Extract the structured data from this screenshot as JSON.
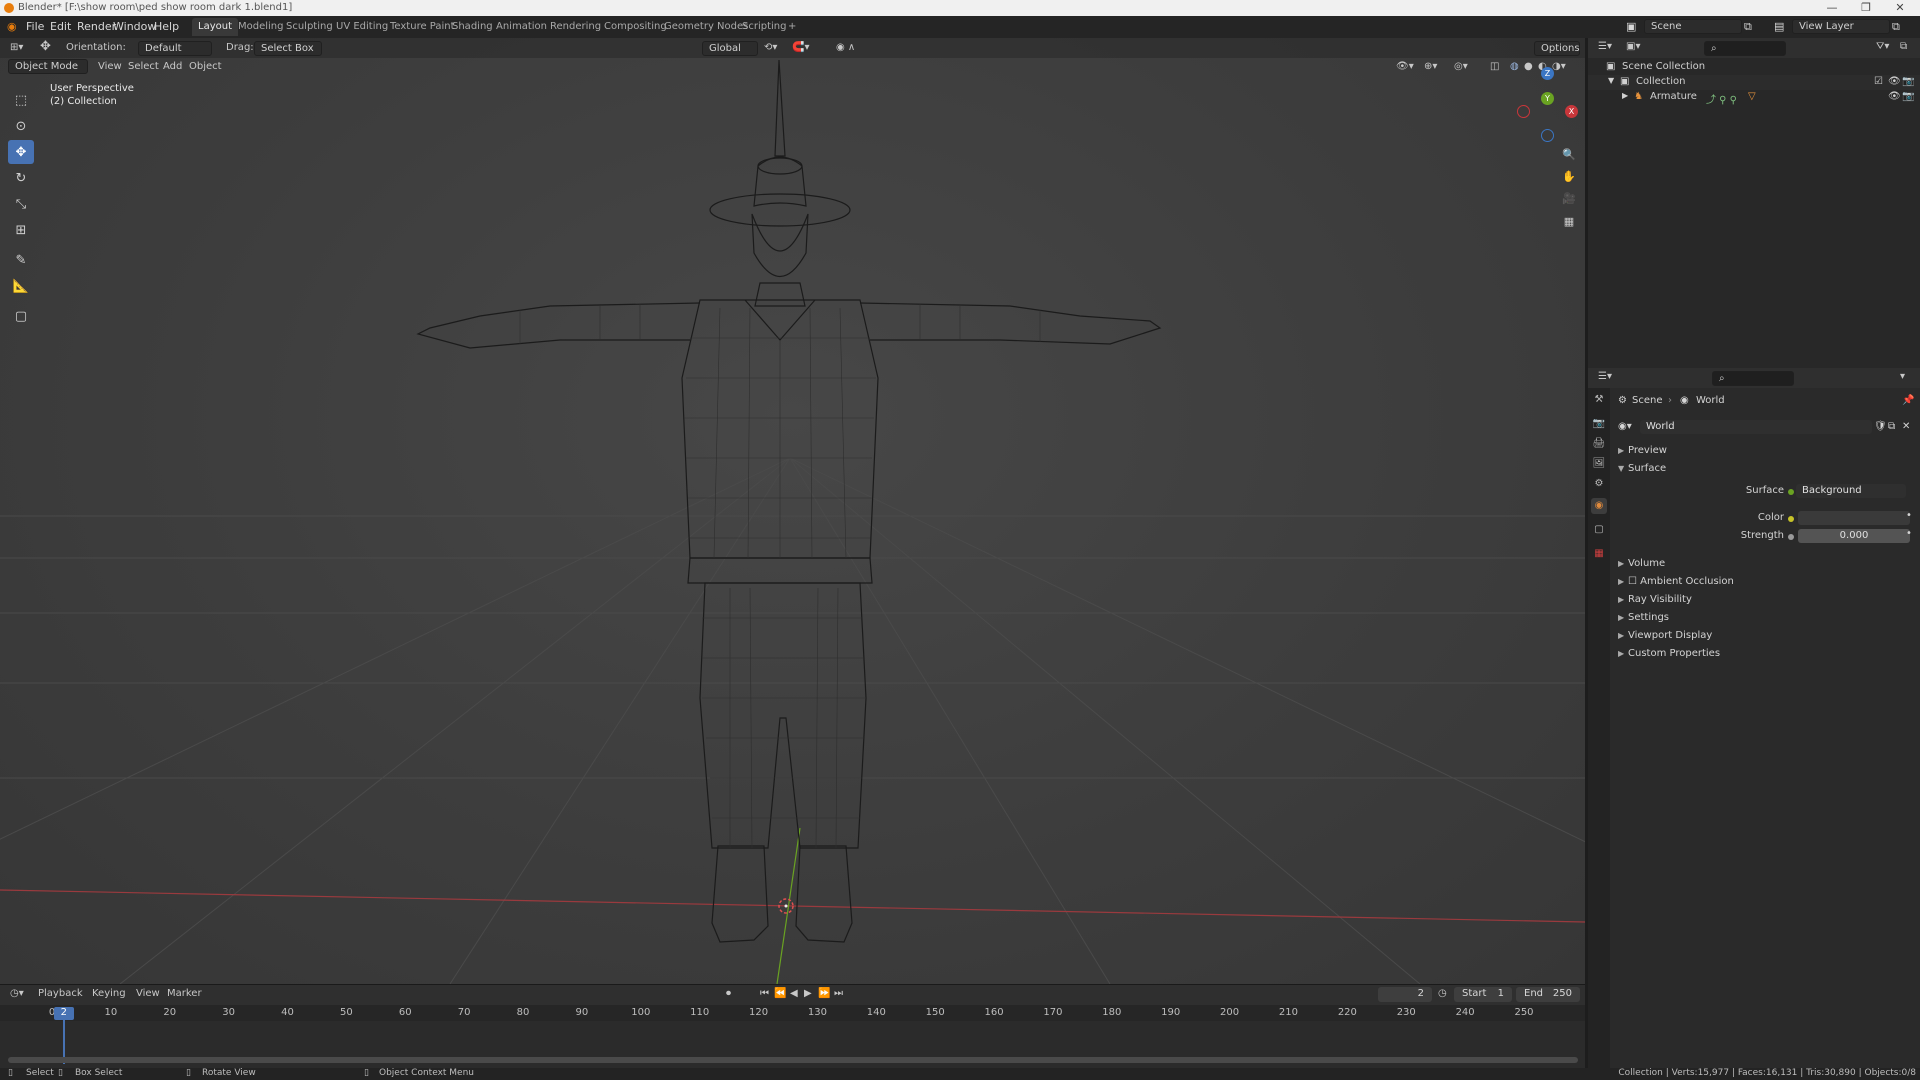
{
  "window": {
    "title": "Blender* [F:\\show room\\ped show room dark 1.blend1]"
  },
  "menu": {
    "file": "File",
    "edit": "Edit",
    "render": "Render",
    "window": "Window",
    "help": "Help"
  },
  "workspaces": [
    "Layout",
    "Modeling",
    "Sculpting",
    "UV Editing",
    "Texture Paint",
    "Shading",
    "Animation",
    "Rendering",
    "Compositing",
    "Geometry Nodes",
    "Scripting"
  ],
  "active_workspace": "Layout",
  "top_right": {
    "scene": "Scene",
    "view_layer": "View Layer"
  },
  "viewport": {
    "orientation_label": "Orientation:",
    "orientation_value": "Default",
    "drag_label": "Drag:",
    "drag_value": "Select Box",
    "transform": "Global",
    "options": "Options",
    "mode": "Object Mode",
    "menus": {
      "view": "View",
      "select": "Select",
      "add": "Add",
      "object": "Object"
    },
    "overlay_line1": "User Perspective",
    "overlay_line2": "(2) Collection",
    "gizmo": {
      "x": "X",
      "y": "Y",
      "z": "Z"
    }
  },
  "timeline": {
    "menus": {
      "playback": "Playback",
      "keying": "Keying",
      "view": "View",
      "marker": "Marker"
    },
    "current_frame": "2",
    "start_label": "Start",
    "start": "1",
    "end_label": "End",
    "end": "250",
    "ticks": [
      "0",
      "10",
      "20",
      "30",
      "40",
      "50",
      "60",
      "70",
      "80",
      "90",
      "100",
      "110",
      "120",
      "130",
      "140",
      "150",
      "160",
      "170",
      "180",
      "190",
      "200",
      "210",
      "220",
      "230",
      "240",
      "250"
    ],
    "playhead": "2"
  },
  "statusbar": {
    "select": "Select",
    "box_select": "Box Select",
    "rotate_view": "Rotate View",
    "context_menu": "Object Context Menu",
    "stats": "Collection | Verts:15,977 | Faces:16,131 | Tris:30,890 | Objects:0/8"
  },
  "outliner": {
    "scene_collection": "Scene Collection",
    "collection": "Collection",
    "armature": "Armature"
  },
  "properties": {
    "breadcrumb_scene": "Scene",
    "breadcrumb_world": "World",
    "world_name": "World",
    "sections": {
      "preview": "Preview",
      "surface": "Surface",
      "volume": "Volume",
      "ambient_occlusion": "Ambient Occlusion",
      "ray_visibility": "Ray Visibility",
      "settings": "Settings",
      "viewport_display": "Viewport Display",
      "custom_properties": "Custom Properties"
    },
    "surface_label": "Surface",
    "surface_value": "Background",
    "color_label": "Color",
    "strength_label": "Strength",
    "strength_value": "0.000"
  },
  "colors": {
    "accent": "#4772b3",
    "x_axis": "#c8363a",
    "y_axis": "#6aa322",
    "z_axis": "#3b76c4"
  }
}
